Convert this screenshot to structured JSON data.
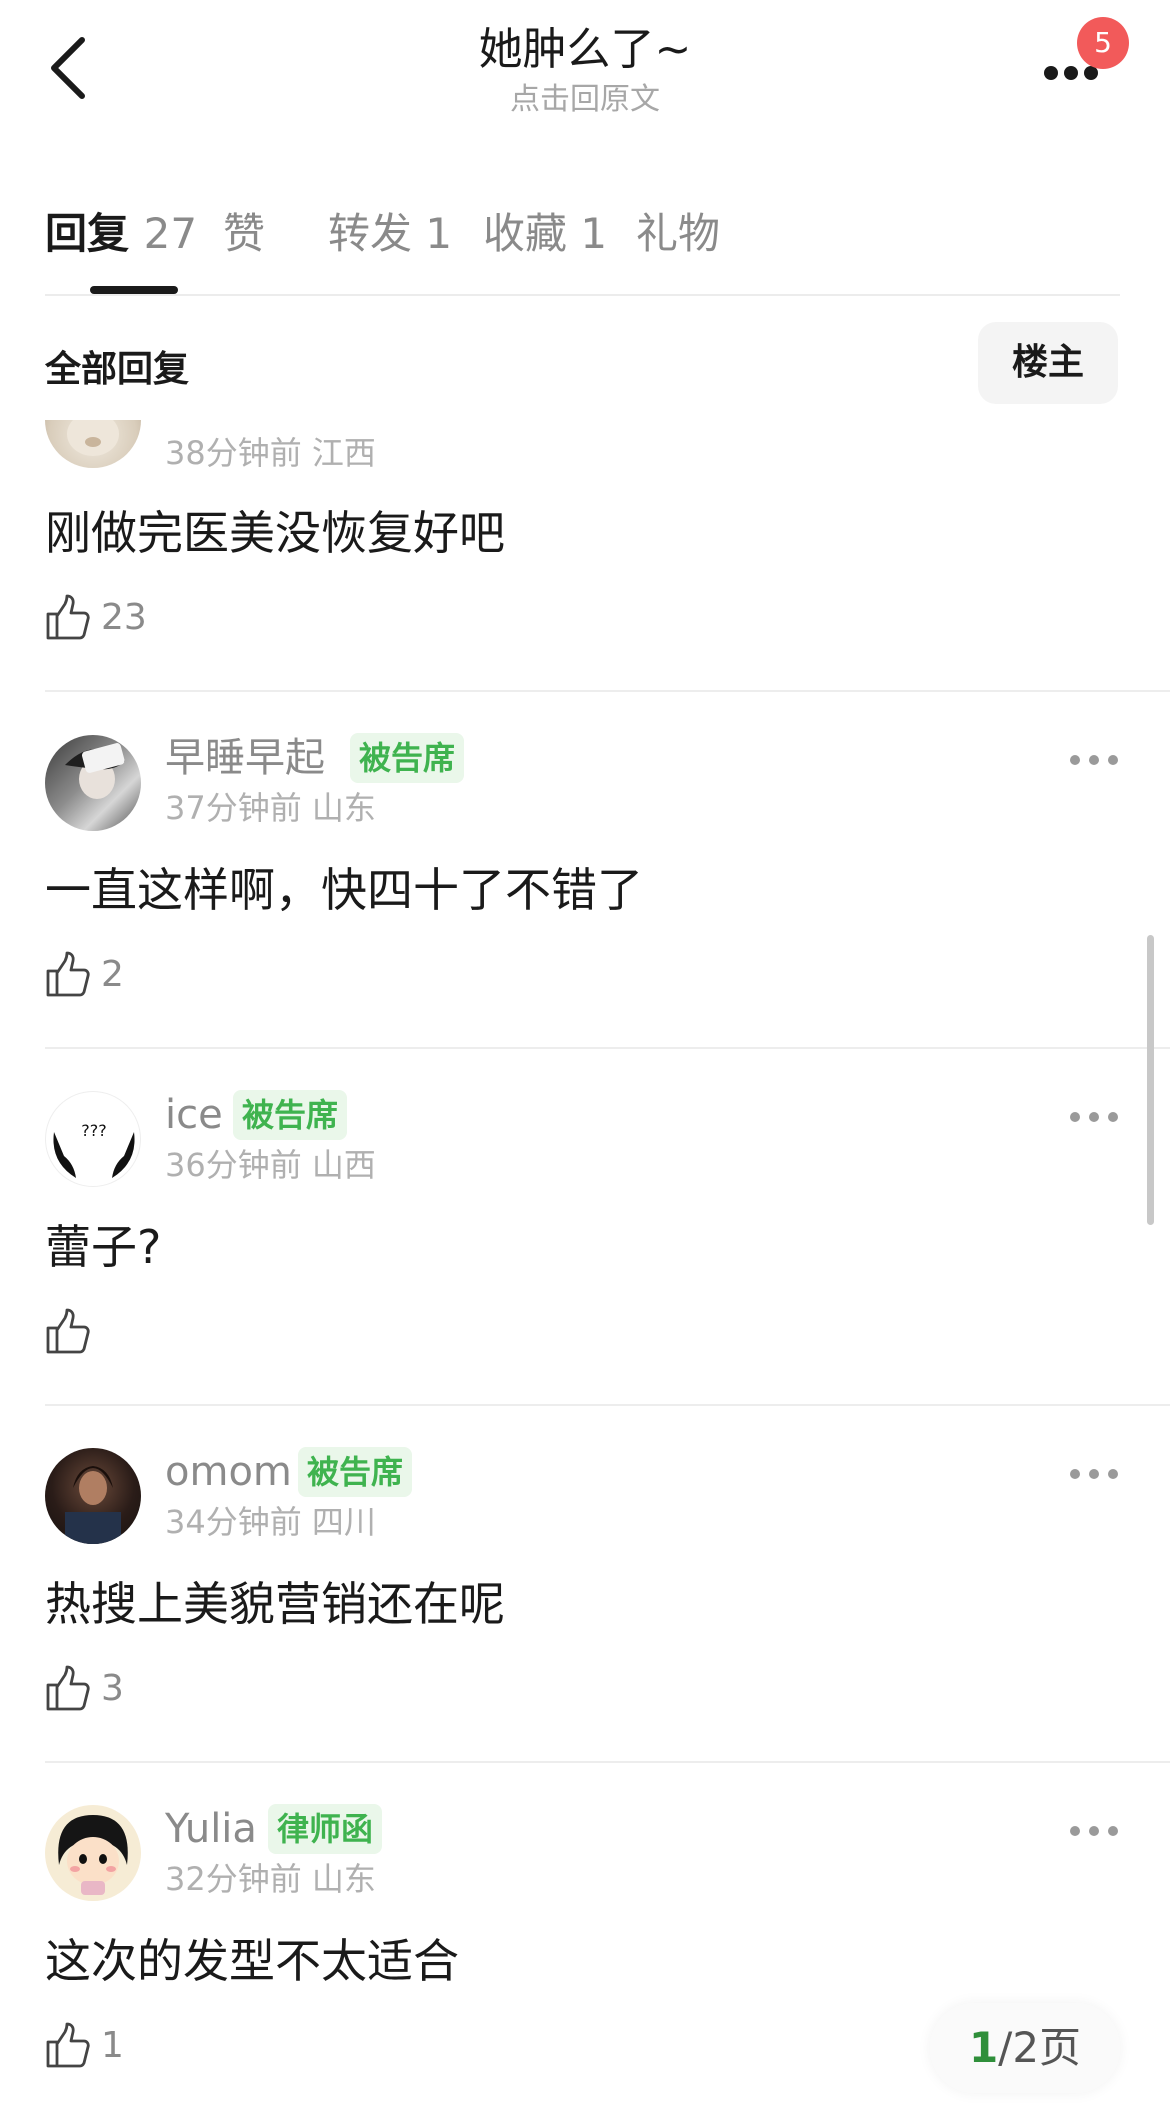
{
  "header": {
    "title": "她肿么了~",
    "subtitle": "点击回原文",
    "badge_count": "5"
  },
  "tabs": [
    {
      "label": "回复",
      "count": "27",
      "active": true
    },
    {
      "label": "赞",
      "count": "",
      "active": false
    },
    {
      "label": "转发",
      "count": "1",
      "active": false
    },
    {
      "label": "收藏",
      "count": "1",
      "active": false
    },
    {
      "label": "礼物",
      "count": "",
      "active": false
    }
  ],
  "filter": {
    "title": "全部回复",
    "owner_button": "楼主"
  },
  "comments": [
    {
      "username": "",
      "tag": "",
      "time": "38分钟前",
      "location": "江西",
      "text": "刚做完医美没恢复好吧",
      "likes": "23"
    },
    {
      "username": "早睡早起",
      "tag": "被告席",
      "time": "37分钟前",
      "location": "山东",
      "text": "一直这样啊，快四十了不错了",
      "likes": "2"
    },
    {
      "username": "ice",
      "tag": "被告席",
      "time": "36分钟前",
      "location": "山西",
      "text": "蕾子?",
      "likes": ""
    },
    {
      "username": "omom",
      "tag": "被告席",
      "time": "34分钟前",
      "location": "四川",
      "text": "热搜上美貌营销还在呢",
      "likes": "3"
    },
    {
      "username": "Yulia",
      "tag": "律师函",
      "time": "32分钟前",
      "location": "山东",
      "text": "这次的发型不太适合",
      "likes": "1"
    }
  ],
  "avatar_caption_ice": "???",
  "pager": {
    "current": "1",
    "total": "/2页"
  },
  "colors": {
    "accent_green": "#3fb34f",
    "badge_red": "#f25a5a",
    "text_dark": "#1a1a1a",
    "text_gray": "#8a8a8a"
  }
}
